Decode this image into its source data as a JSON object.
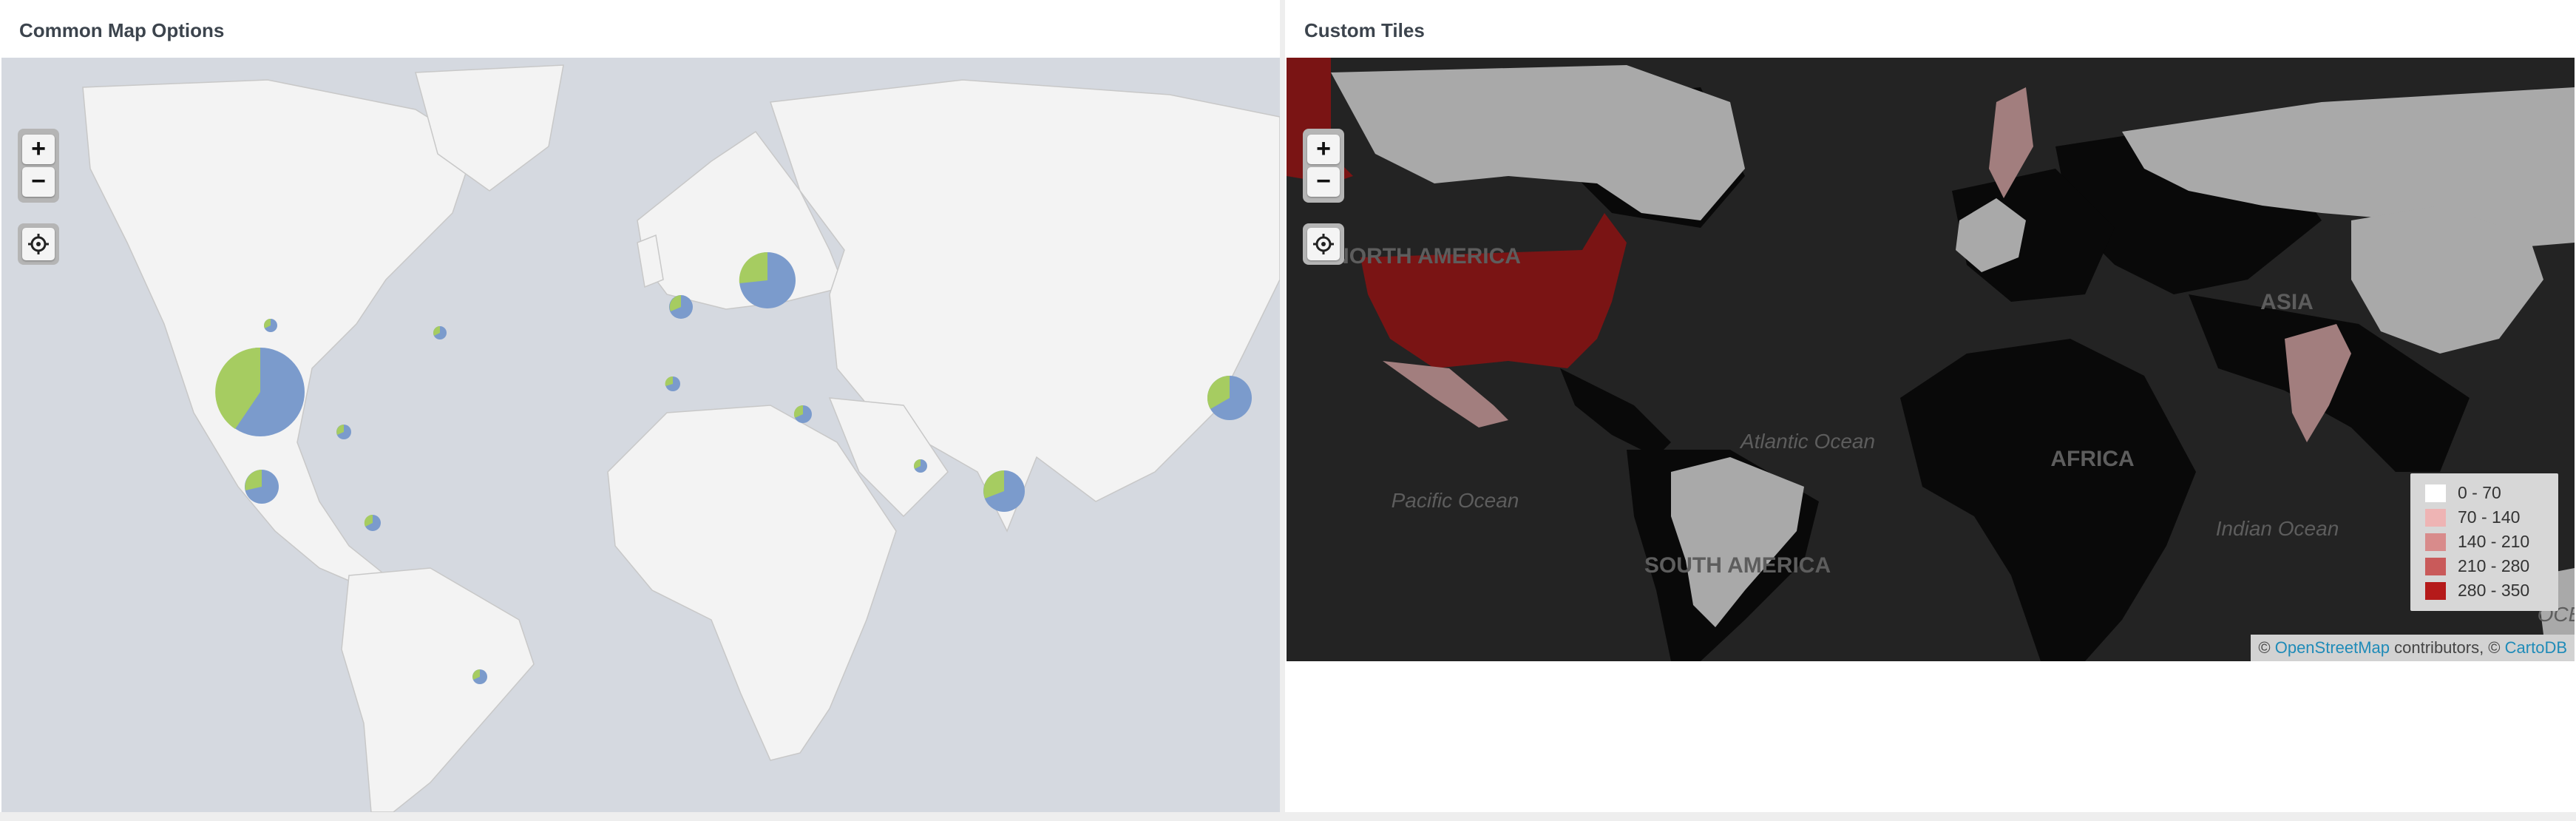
{
  "left_panel": {
    "title": "Common Map Options",
    "zoom_in": "+",
    "zoom_out": "−",
    "colors": {
      "water": "#d5d9e0",
      "land": "#f3f3f3",
      "series_a": "#7b9bcc",
      "series_b": "#a6cc61"
    }
  },
  "right_panel": {
    "title": "Custom Tiles",
    "zoom_in": "+",
    "zoom_out": "−",
    "map_labels": {
      "north_america": "NORTH AMERICA",
      "south_america": "SOUTH AMERICA",
      "asia": "ASIA",
      "africa": "AFRICA",
      "atlantic": "Atlantic Ocean",
      "pacific": "Pacific Ocean",
      "indian": "Indian Ocean",
      "oceania": "OCE"
    },
    "legend": [
      {
        "label": "0 - 70",
        "color": "#ffffff"
      },
      {
        "label": "70 - 140",
        "color": "#eeb4b4"
      },
      {
        "label": "140 - 210",
        "color": "#d88b8b"
      },
      {
        "label": "210 - 280",
        "color": "#c95a5a"
      },
      {
        "label": "280 - 350",
        "color": "#b51a1a"
      }
    ],
    "attribution": {
      "prefix": "© ",
      "osm": "OpenStreetMap",
      "middle": " contributors, © ",
      "carto": "CartoDB"
    },
    "colors": {
      "ocean": "#232323",
      "land": "#090909",
      "gray_country": "#a9a9a9",
      "highlight": "#7a1414",
      "light_red": "#a27e7e"
    }
  }
}
